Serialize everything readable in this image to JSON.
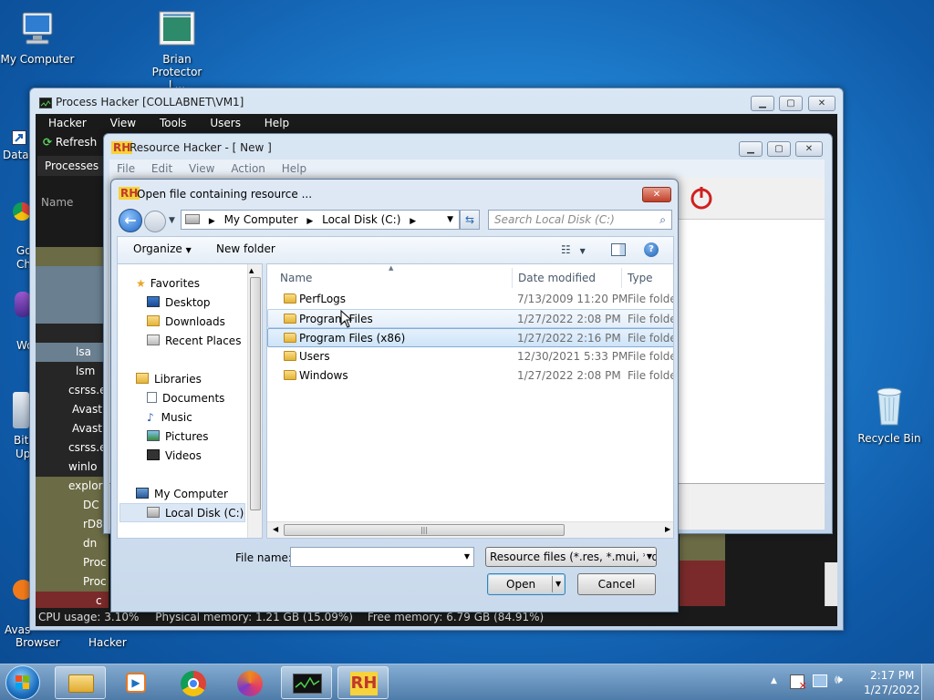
{
  "desktop": {
    "icons": [
      {
        "label": "My Computer"
      },
      {
        "label": "Brian Protector L..."
      },
      {
        "label": "Recycle Bin"
      }
    ],
    "edge_labels": [
      "DataV",
      "Go",
      "Ch",
      "Wo",
      "Bit",
      "Up",
      "Avas",
      "Browser",
      "Hacker"
    ]
  },
  "process_hacker": {
    "title": "Process Hacker [COLLABNET\\VM1]",
    "menu": [
      "Hacker",
      "View",
      "Tools",
      "Users",
      "Help"
    ],
    "refresh_label": "Refresh",
    "tab_processes": "Processes",
    "column_name": "Name",
    "rows": [
      "lsa",
      "lsm",
      "csrss.e",
      "Avast",
      "Avast",
      "csrss.e",
      "winlo",
      "explor",
      "DC",
      "rD8",
      "dn",
      "Proc",
      "Proc",
      "c"
    ],
    "status": {
      "cpu": "CPU usage: 3.10%",
      "physical": "Physical memory: 1.21 GB (15.09%)",
      "free": "Free memory: 6.79 GB (84.91%)"
    }
  },
  "resource_hacker": {
    "title": "Resource Hacker - [ New ]",
    "menu": [
      "File",
      "Edit",
      "View",
      "Action",
      "Help"
    ]
  },
  "dialog": {
    "title": "Open file containing resource ...",
    "breadcrumb": [
      "My Computer",
      "Local Disk (C:)"
    ],
    "search_placeholder": "Search Local Disk (C:)",
    "organize_label": "Organize",
    "new_folder_label": "New folder",
    "nav": {
      "favorites_header": "Favorites",
      "favorites": [
        "Desktop",
        "Downloads",
        "Recent Places"
      ],
      "libraries_header": "Libraries",
      "libraries": [
        "Documents",
        "Music",
        "Pictures",
        "Videos"
      ],
      "computer_header": "My Computer",
      "computer_items": [
        "Local Disk (C:)"
      ]
    },
    "columns": {
      "name": "Name",
      "date": "Date modified",
      "type": "Type"
    },
    "files": [
      {
        "name": "PerfLogs",
        "date": "7/13/2009 11:20 PM",
        "type": "File folder"
      },
      {
        "name": "Program Files",
        "date": "1/27/2022 2:08 PM",
        "type": "File folder"
      },
      {
        "name": "Program Files (x86)",
        "date": "1/27/2022 2:16 PM",
        "type": "File folder"
      },
      {
        "name": "Users",
        "date": "12/30/2021 5:33 PM",
        "type": "File folder"
      },
      {
        "name": "Windows",
        "date": "1/27/2022 2:08 PM",
        "type": "File folder"
      }
    ],
    "file_name_label": "File name:",
    "file_name_value": "",
    "filter_value": "Resource files (*.res, *.mui, *.dll",
    "open_label": "Open",
    "cancel_label": "Cancel"
  },
  "taskbar": {
    "clock_time": "2:17 PM",
    "clock_date": "1/27/2022"
  }
}
